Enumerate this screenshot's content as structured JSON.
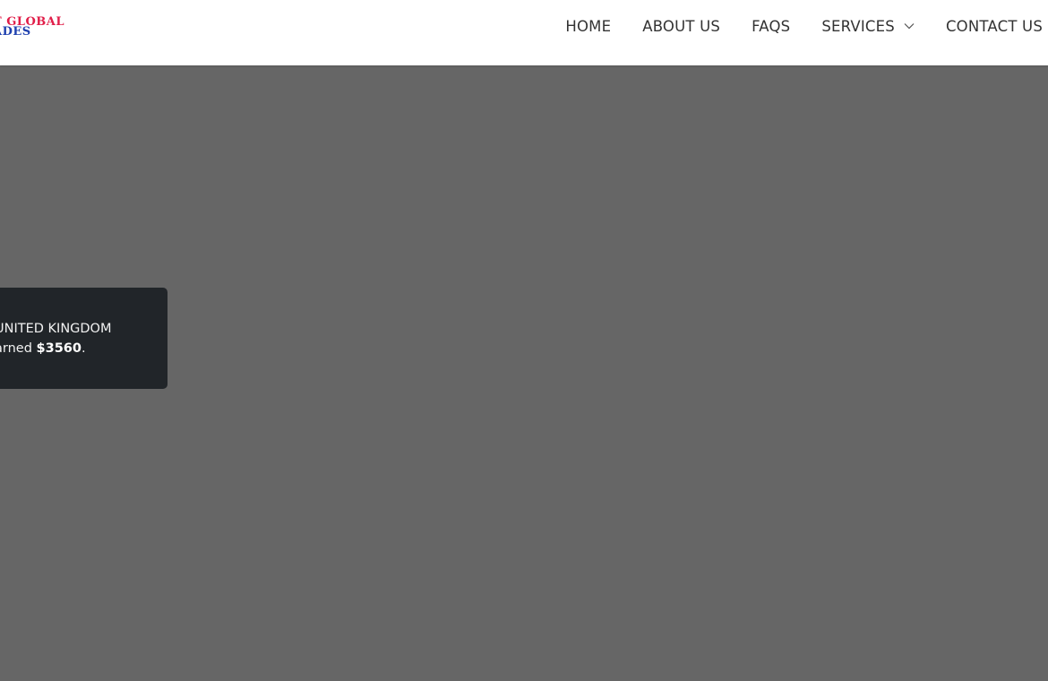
{
  "brand": {
    "logo_line1": "T GLOBAL",
    "logo_line2": "ADES",
    "logo_color_top": "#e11d48",
    "logo_color_bottom": "#1e40af"
  },
  "nav": {
    "items": [
      {
        "label": "HOME"
      },
      {
        "label": "ABOUT US"
      },
      {
        "label": "FAQS"
      },
      {
        "label": "SERVICES",
        "has_dropdown": true,
        "icon": "chevron-down-icon"
      },
      {
        "label": "CONTACT US"
      }
    ]
  },
  "notification": {
    "country": "UNITED KINGDOM",
    "earned_prefix": "arned",
    "amount": "$3560",
    "suffix": "."
  },
  "colors": {
    "background_overlay": "#666666",
    "toast_bg": "#212529",
    "header_bg": "#ffffff"
  }
}
